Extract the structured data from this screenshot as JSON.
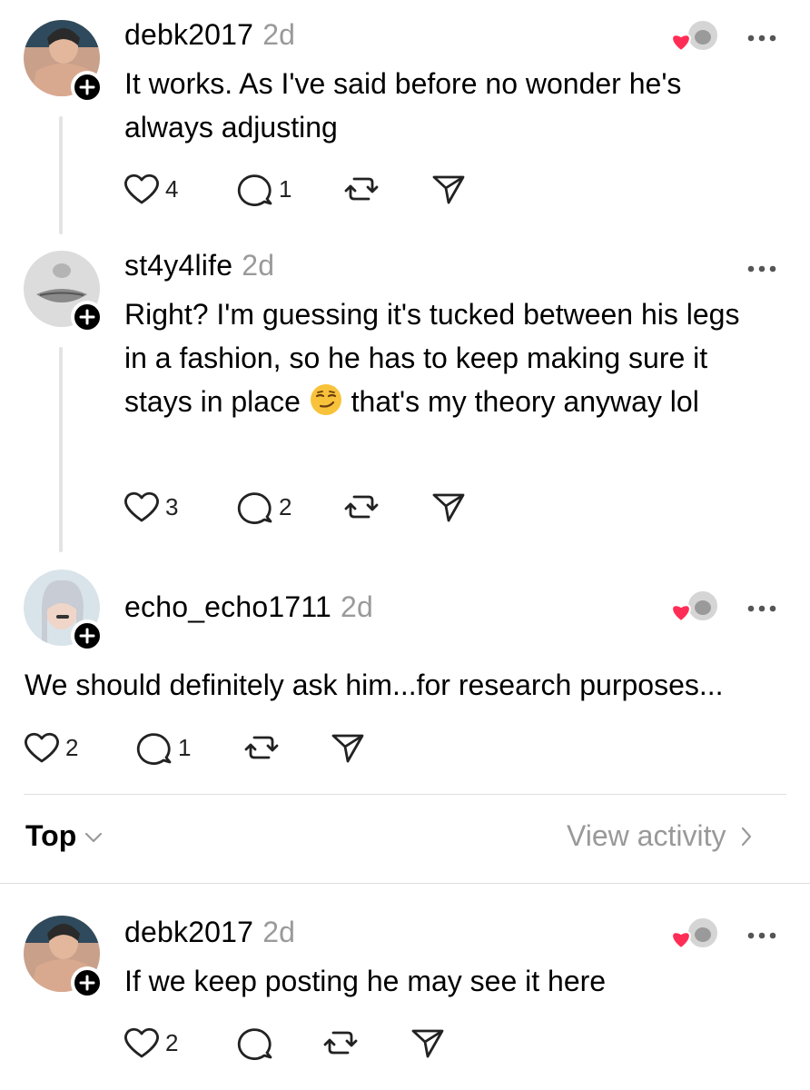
{
  "comments": [
    {
      "username": "debk2017",
      "time": "2d",
      "text": "It works. As I've said before no wonder he's always adjusting",
      "likes": "4",
      "replies": "1"
    },
    {
      "username": "st4y4life",
      "time": "2d",
      "text_before": "Right? I'm guessing it's tucked between his legs in a fashion, so he has to keep making sure it stays in place",
      "emoji": "smirking-face",
      "text_after": "that's my theory anyway lol",
      "likes": "3",
      "replies": "2"
    },
    {
      "username": "echo_echo1711",
      "time": "2d",
      "text": "We should definitely ask him...for research purposes...",
      "likes": "2",
      "replies": "1"
    },
    {
      "username": "debk2017",
      "time": "2d",
      "text": "If we keep posting he may see it here",
      "likes": "2",
      "replies": ""
    }
  ],
  "footer": {
    "sort_label": "Top",
    "view_activity_label": "View activity"
  },
  "colors": {
    "heart_red": "#ff2d55",
    "muted": "#999999",
    "divider": "#dedede"
  }
}
